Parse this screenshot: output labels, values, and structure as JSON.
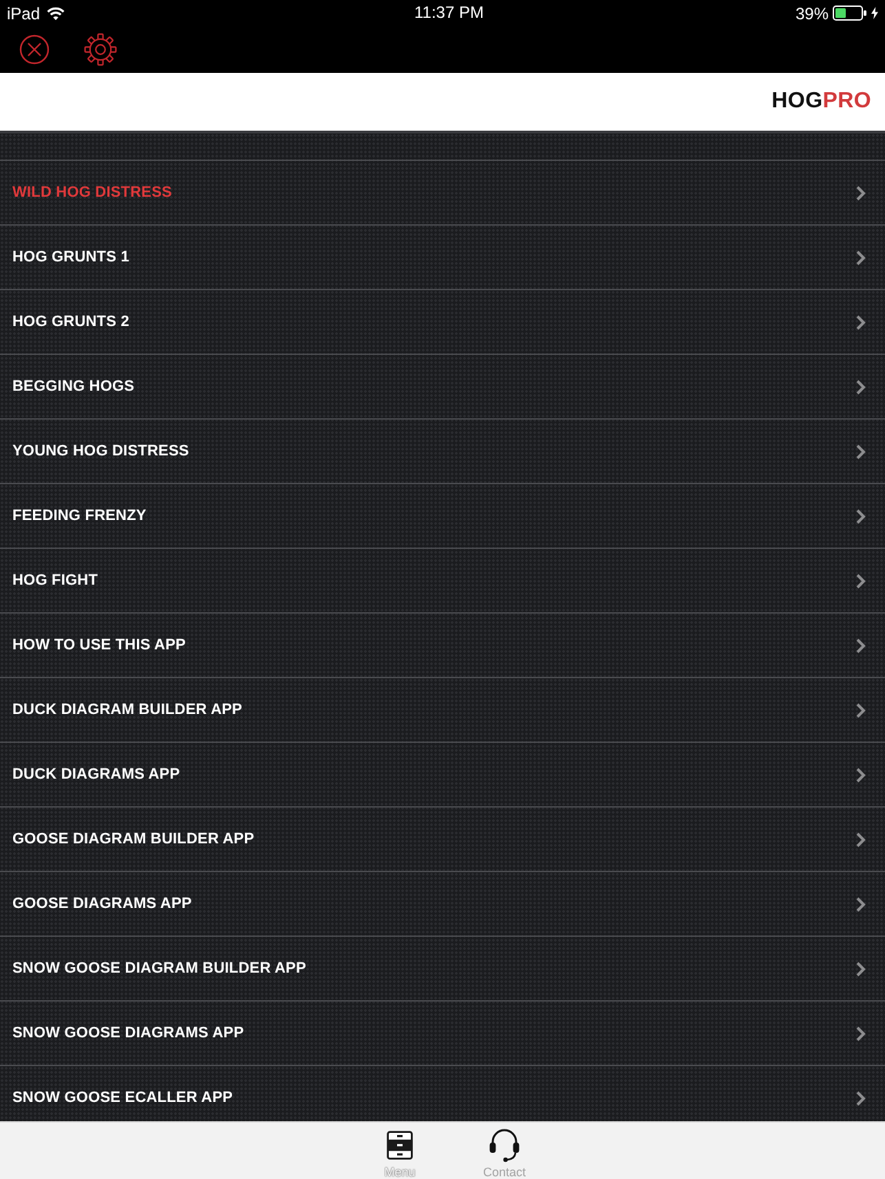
{
  "status_bar": {
    "device": "iPad",
    "time": "11:37 PM",
    "battery": "39%"
  },
  "header": {
    "logo": [
      {
        "text": "HOG",
        "kind": "dark"
      },
      {
        "text": "PRO",
        "kind": "accent"
      }
    ]
  },
  "menu": {
    "items": [
      {
        "label": "WILD HOG DISTRESS",
        "selected": true
      },
      {
        "label": "HOG GRUNTS 1",
        "selected": false
      },
      {
        "label": "HOG GRUNTS 2",
        "selected": false
      },
      {
        "label": "BEGGING HOGS",
        "selected": false
      },
      {
        "label": "YOUNG HOG DISTRESS",
        "selected": false
      },
      {
        "label": "FEEDING FRENZY",
        "selected": false
      },
      {
        "label": "HOG FIGHT",
        "selected": false
      },
      {
        "label": "HOW TO USE THIS APP",
        "selected": false
      },
      {
        "label": "DUCK DIAGRAM BUILDER APP",
        "selected": false
      },
      {
        "label": "DUCK DIAGRAMS APP",
        "selected": false
      },
      {
        "label": "GOOSE DIAGRAM BUILDER APP",
        "selected": false
      },
      {
        "label": "GOOSE DIAGRAMS APP",
        "selected": false
      },
      {
        "label": "SNOW GOOSE DIAGRAM BUILDER APP",
        "selected": false
      },
      {
        "label": "SNOW GOOSE DIAGRAMS APP",
        "selected": false
      },
      {
        "label": "SNOW GOOSE ECALLER APP",
        "selected": false
      }
    ]
  },
  "tab_bar": {
    "tabs": [
      {
        "label": "Menu",
        "selected": true
      },
      {
        "label": "Contact",
        "selected": false
      }
    ]
  }
}
